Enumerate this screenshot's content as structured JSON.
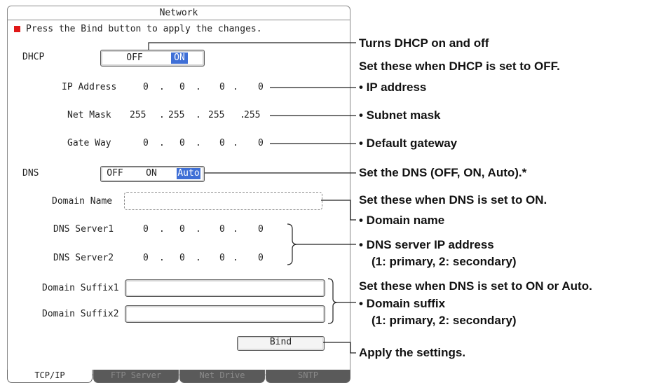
{
  "window": {
    "title": "Network"
  },
  "notice": "Press the Bind button to apply the changes.",
  "dhcp": {
    "label": "DHCP",
    "options": [
      "OFF",
      "ON"
    ],
    "selected": "ON"
  },
  "ip_address": {
    "label": "IP Address",
    "octets": [
      "0",
      "0",
      "0",
      "0"
    ]
  },
  "net_mask": {
    "label": "Net Mask",
    "octets": [
      "255",
      "255",
      "255",
      "255"
    ]
  },
  "gateway": {
    "label": "Gate Way",
    "octets": [
      "0",
      "0",
      "0",
      "0"
    ]
  },
  "dns": {
    "label": "DNS",
    "options": [
      "OFF",
      "ON",
      "Auto"
    ],
    "selected": "Auto"
  },
  "domain_name": {
    "label": "Domain Name",
    "value": ""
  },
  "dns_server1": {
    "label": "DNS Server1",
    "octets": [
      "0",
      "0",
      "0",
      "0"
    ]
  },
  "dns_server2": {
    "label": "DNS Server2",
    "octets": [
      "0",
      "0",
      "0",
      "0"
    ]
  },
  "domain_suffix1": {
    "label": "Domain Suffix1",
    "value": ""
  },
  "domain_suffix2": {
    "label": "Domain Suffix2",
    "value": ""
  },
  "bind_button": {
    "label": "Bind"
  },
  "tabs": [
    {
      "label": "TCP/IP",
      "active": true
    },
    {
      "label": "FTP Server",
      "active": false
    },
    {
      "label": "Net Drive",
      "active": false
    },
    {
      "label": "SNTP",
      "active": false
    }
  ],
  "annotations": {
    "dhcp": "Turns DHCP on and off",
    "dhcp_off_header": "Set these when DHCP is set to OFF.",
    "ip": "• IP address",
    "mask": "• Subnet mask",
    "gateway": "• Default gateway",
    "dns": "Set the DNS (OFF, ON, Auto).*",
    "dns_on_header": "Set these when DNS is set to ON.",
    "domain_name": "• Domain name",
    "dns_server": "• DNS server IP address",
    "dns_server_sub": "(1: primary, 2: secondary)",
    "suffix_header": "Set these when DNS is set to ON or Auto.",
    "suffix": "• Domain suffix",
    "suffix_sub": "(1: primary, 2: secondary)",
    "bind": "Apply the settings."
  },
  "colors": {
    "selected": "#3f6fd6",
    "notice_marker": "#e01818",
    "inactive_tab": "#5a5a5a"
  }
}
